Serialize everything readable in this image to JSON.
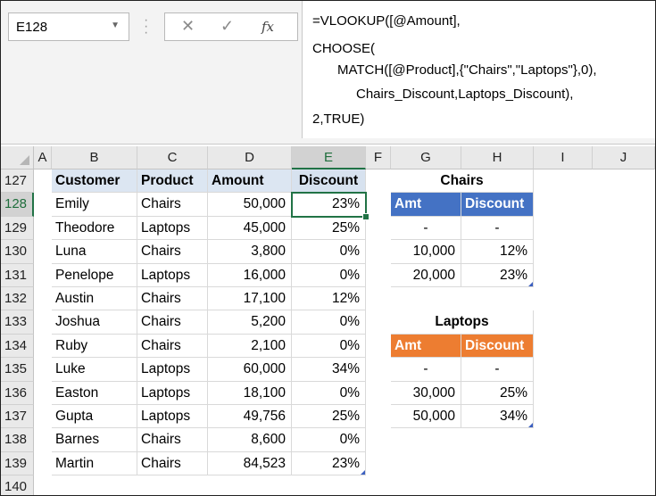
{
  "formula_bar": {
    "name_box": "E128",
    "cancel_glyph": "✕",
    "enter_glyph": "✓",
    "fx_glyph": "fx",
    "formula_lines": [
      "=VLOOKUP([@Amount],",
      "CHOOSE(",
      "MATCH([@Product],{\"Chairs\",\"Laptops\"},0),",
      "Chairs_Discount,Laptops_Discount),",
      "2,TRUE)"
    ]
  },
  "columns": [
    "A",
    "B",
    "C",
    "D",
    "E",
    "F",
    "G",
    "H",
    "I",
    "J"
  ],
  "rows": [
    "127",
    "128",
    "129",
    "130",
    "131",
    "132",
    "133",
    "134",
    "135",
    "136",
    "137",
    "138",
    "139",
    "140"
  ],
  "table": {
    "headers": [
      "Customer",
      "Product",
      "Amount",
      "Discount"
    ],
    "records": [
      {
        "customer": "Emily",
        "product": "Chairs",
        "amount": "50,000",
        "discount": "23%"
      },
      {
        "customer": "Theodore",
        "product": "Laptops",
        "amount": "45,000",
        "discount": "25%"
      },
      {
        "customer": "Luna",
        "product": "Chairs",
        "amount": "3,800",
        "discount": "0%"
      },
      {
        "customer": "Penelope",
        "product": "Laptops",
        "amount": "16,000",
        "discount": "0%"
      },
      {
        "customer": "Austin",
        "product": "Chairs",
        "amount": "17,100",
        "discount": "12%"
      },
      {
        "customer": "Joshua",
        "product": "Chairs",
        "amount": "5,200",
        "discount": "0%"
      },
      {
        "customer": "Ruby",
        "product": "Chairs",
        "amount": "2,100",
        "discount": "0%"
      },
      {
        "customer": "Luke",
        "product": "Laptops",
        "amount": "60,000",
        "discount": "34%"
      },
      {
        "customer": "Easton",
        "product": "Laptops",
        "amount": "18,100",
        "discount": "0%"
      },
      {
        "customer": "Gupta",
        "product": "Laptops",
        "amount": "49,756",
        "discount": "25%"
      },
      {
        "customer": "Barnes",
        "product": "Chairs",
        "amount": "8,600",
        "discount": "0%"
      },
      {
        "customer": "Martin",
        "product": "Chairs",
        "amount": "84,523",
        "discount": "23%"
      }
    ]
  },
  "chairs_table": {
    "title": "Chairs",
    "headers": [
      "Amt",
      "Discount"
    ],
    "rows": [
      [
        "-",
        "-"
      ],
      [
        "10,000",
        "12%"
      ],
      [
        "20,000",
        "23%"
      ]
    ]
  },
  "laptops_table": {
    "title": "Laptops",
    "headers": [
      "Amt",
      "Discount"
    ],
    "rows": [
      [
        "-",
        "-"
      ],
      [
        "30,000",
        "25%"
      ],
      [
        "50,000",
        "34%"
      ]
    ]
  },
  "colors": {
    "chairs_header": "#4472c4",
    "laptops_header": "#ed7d31",
    "selection": "#217346"
  }
}
